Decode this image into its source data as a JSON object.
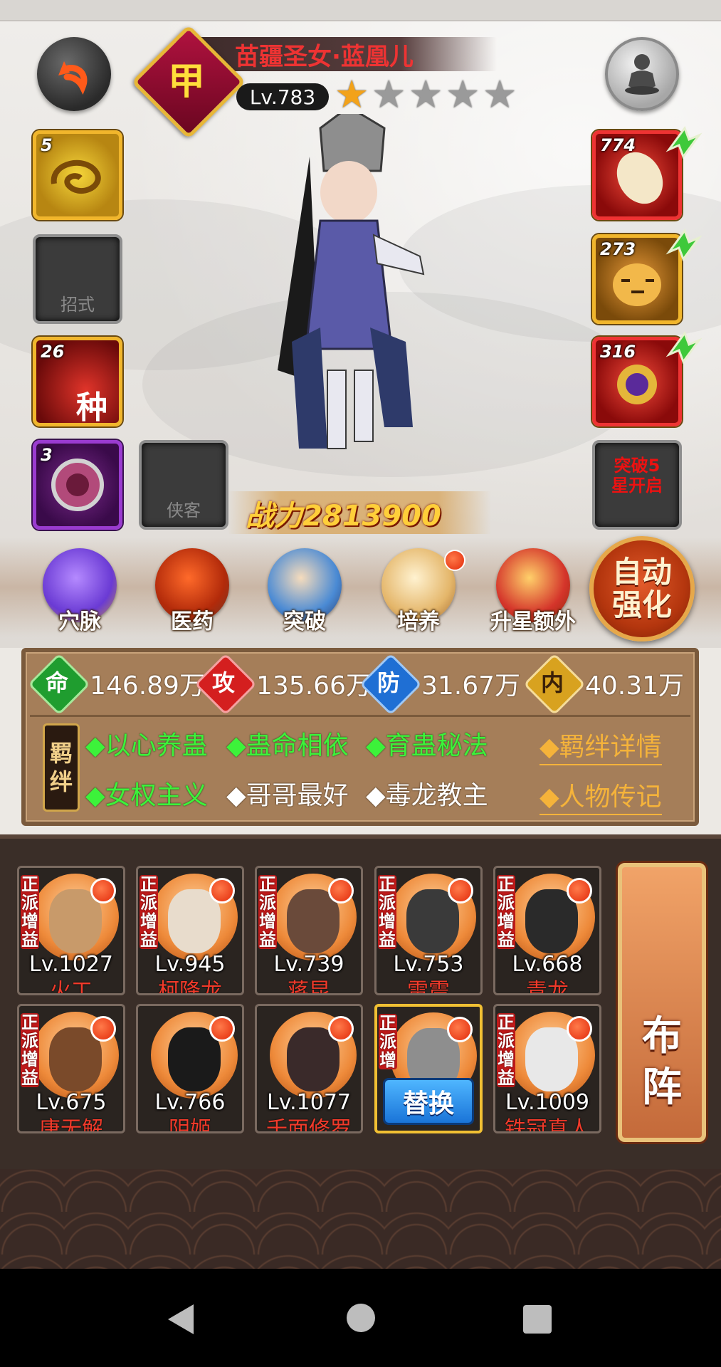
{
  "hero": {
    "name": "苗疆圣女·蓝凰儿",
    "rank_char": "甲",
    "level": "Lv.783",
    "stars_filled": 1,
    "stars_total": 5,
    "power": "战力2813900"
  },
  "left_slots": [
    {
      "count": "5",
      "label": ""
    },
    {
      "count": "",
      "label": "招式"
    },
    {
      "count": "26",
      "label": "",
      "glyph": "种"
    },
    {
      "count": "3",
      "label": ""
    },
    {
      "count": "",
      "label": "侠客"
    }
  ],
  "right_slots": [
    {
      "count": "774"
    },
    {
      "count": "273"
    },
    {
      "count": "316"
    },
    {
      "locked_text_1": "突破5",
      "locked_text_2": "星开启"
    }
  ],
  "functions": [
    {
      "label": "穴脉",
      "icon": "meridian-icon"
    },
    {
      "label": "医药",
      "icon": "medicine-icon"
    },
    {
      "label": "突破",
      "icon": "breakthrough-icon"
    },
    {
      "label": "培养",
      "icon": "scroll-icon",
      "badge": true
    },
    {
      "label": "升星额外",
      "icon": "armor-icon"
    }
  ],
  "auto_button": {
    "line1": "自动",
    "line2": "强化"
  },
  "stats": [
    {
      "icon_char": "命",
      "value": "146.89万",
      "color": "#1f9d2f"
    },
    {
      "icon_char": "攻",
      "value": "135.66万",
      "color": "#d41f1f"
    },
    {
      "icon_char": "防",
      "value": "31.67万",
      "color": "#1f6fd4"
    },
    {
      "icon_char": "内",
      "value": "40.31万",
      "color": "#d8a21f"
    }
  ],
  "bond_tag": {
    "line1": "羁",
    "line2": "绊"
  },
  "bonds_row1": [
    {
      "text": "◆以心养蛊",
      "active": true
    },
    {
      "text": "◆蛊命相依",
      "active": true
    },
    {
      "text": "◆育蛊秘法",
      "active": true
    }
  ],
  "bonds_row2": [
    {
      "text": "◆女权主义",
      "active": true
    },
    {
      "text": "◆哥哥最好",
      "active": false
    },
    {
      "text": "◆毒龙教主",
      "active": false
    }
  ],
  "links": {
    "bond_detail": "◆羁绊详情",
    "biography": "◆人物传记"
  },
  "roster_tag": {
    "c1": "正",
    "c2": "派",
    "c3": "增",
    "c4": "益"
  },
  "roster": [
    {
      "level": "Lv.1027",
      "name": "火工"
    },
    {
      "level": "Lv.945",
      "name": "柯降龙"
    },
    {
      "level": "Lv.739",
      "name": "蒋昆"
    },
    {
      "level": "Lv.753",
      "name": "雷震"
    },
    {
      "level": "Lv.668",
      "name": "青龙"
    },
    {
      "level": "Lv.675",
      "name": "唐无解"
    },
    {
      "level": "Lv.766",
      "name": "阴姬"
    },
    {
      "level": "Lv.1077",
      "name": "千面修罗"
    },
    {
      "level": "",
      "name": "",
      "selected": true
    },
    {
      "level": "Lv.1009",
      "name": "铁冠真人"
    }
  ],
  "swap_button": "替换",
  "formation_button": {
    "c1": "布",
    "c2": "阵"
  }
}
